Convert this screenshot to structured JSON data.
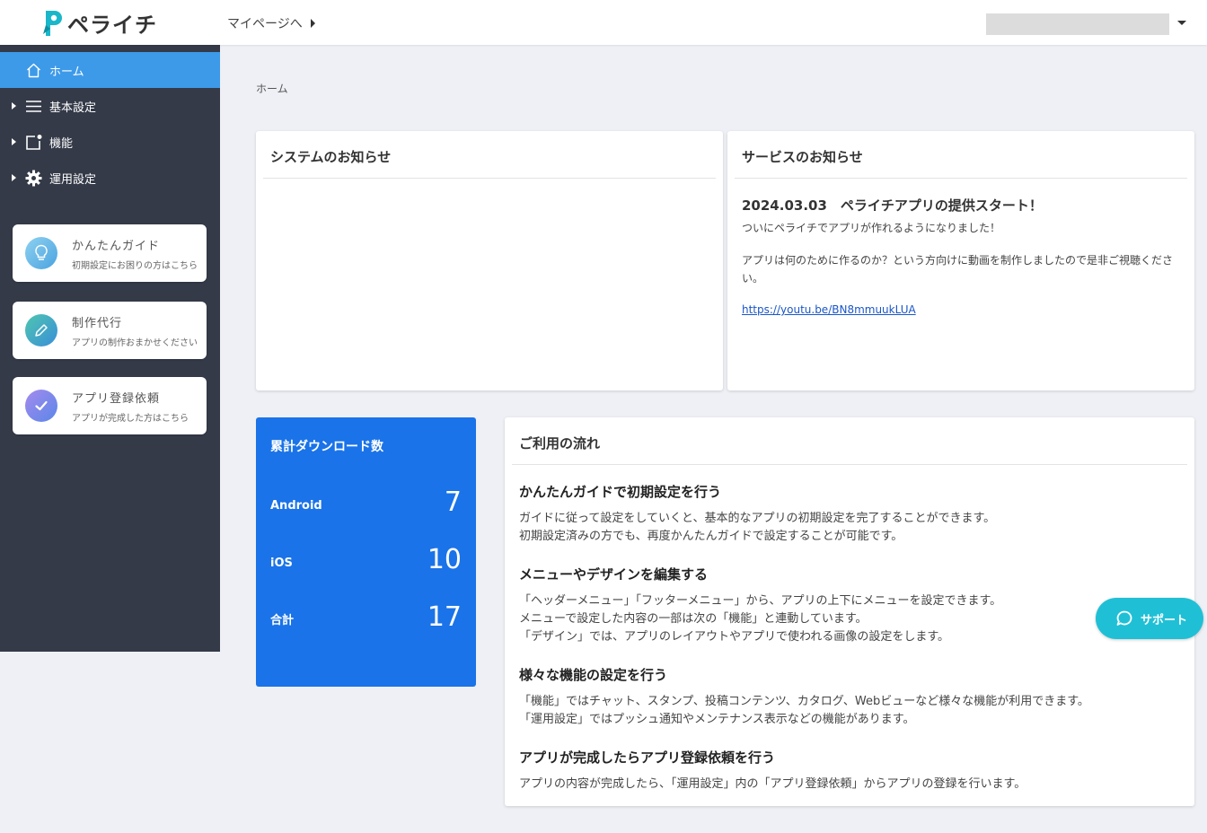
{
  "header": {
    "logo_text": "ペライチ",
    "mypage_link": "マイページへ"
  },
  "sidebar": {
    "items": [
      {
        "label": "ホーム"
      },
      {
        "label": "基本設定"
      },
      {
        "label": "機能"
      },
      {
        "label": "運用設定"
      }
    ],
    "guides": [
      {
        "title": "かんたんガイド",
        "subtitle": "初期設定にお困りの方はこちら"
      },
      {
        "title": "制作代行",
        "subtitle": "アプリの制作おまかせください"
      },
      {
        "title": "アプリ登録依頼",
        "subtitle": "アプリが完成した方はこちら"
      }
    ]
  },
  "breadcrumb": "ホーム",
  "system_news": {
    "title": "システムのお知らせ"
  },
  "service_news": {
    "title": "サービスのお知らせ",
    "date_headline": "2024.03.03　ペライチアプリの提供スタート！",
    "line1": "ついにペライチでアプリが作れるようになりました！",
    "line2": "アプリは何のために作るのか？という方向けに動画を制作しましたので是非ご視聴ください。",
    "link": "https://youtu.be/BN8mmuukLUA"
  },
  "downloads": {
    "title": "累計ダウンロード数",
    "rows": [
      {
        "label": "Android",
        "value": "7"
      },
      {
        "label": "iOS",
        "value": "10"
      },
      {
        "label": "合計",
        "value": "17"
      }
    ]
  },
  "flow": {
    "title": "ご利用の流れ",
    "sections": [
      {
        "heading": "かんたんガイドで初期設定を行う",
        "lines": [
          "ガイドに従って設定をしていくと、基本的なアプリの初期設定を完了することができます。",
          "初期設定済みの方でも、再度かんたんガイドで設定することが可能です。"
        ]
      },
      {
        "heading": "メニューやデザインを編集する",
        "lines": [
          "「ヘッダーメニュー」「フッターメニュー」から、アプリの上下にメニューを設定できます。",
          "メニューで設定した内容の一部は次の「機能」と連動しています。",
          "「デザイン」では、アプリのレイアウトやアプリで使われる画像の設定をします。"
        ]
      },
      {
        "heading": "様々な機能の設定を行う",
        "lines": [
          "「機能」ではチャット、スタンプ、投稿コンテンツ、カタログ、Webビューなど様々な機能が利用できます。",
          "「運用設定」ではプッシュ通知やメンテナンス表示などの機能があります。"
        ]
      },
      {
        "heading": "アプリが完成したらアプリ登録依頼を行う",
        "lines": [
          "アプリの内容が完成したら、「運用設定」内の「アプリ登録依頼」からアプリの登録を行います。"
        ]
      }
    ]
  },
  "support": {
    "label": "サポート"
  },
  "colors": {
    "sidebar_bg": "#343a48",
    "active_nav": "#3d9ae9",
    "download_card": "#1a73e8",
    "support_button": "#1fc0d6",
    "link": "#1a56c9"
  }
}
